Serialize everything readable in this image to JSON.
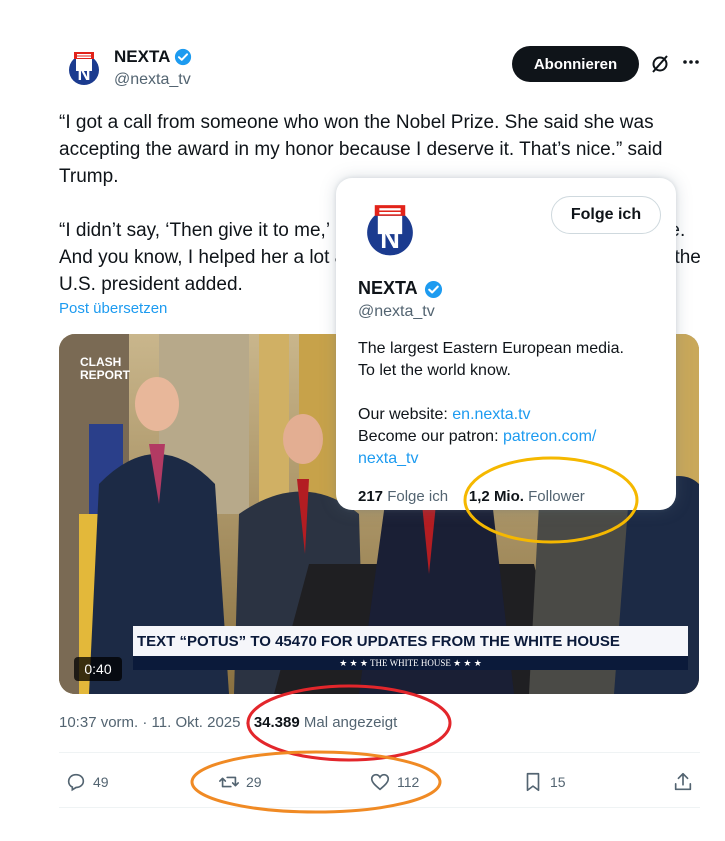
{
  "header": {
    "name": "NEXTA",
    "handle": "@nexta_tv",
    "subscribe_label": "Abonnieren"
  },
  "tweet": {
    "text": "“I got a call from someone who won the Nobel Prize. She said she was accepting the award in my honor because I deserve it. That’s nice.” said Trump.\n\n“I didn’t say, ‘Then give it to me,’ I didn’t say that. I think she was very nice. And you know, I helped her a lot along the way. A disaster in Venezuela,” the U.S. president added.",
    "translate_label": "Post übersetzen"
  },
  "media": {
    "brand_top": "CLASH",
    "brand_bottom": "REPORT",
    "banner_text": "TEXT “POTUS” TO 45470 FOR UPDATES FROM THE WHITE HOUSE",
    "banner_sub": "★ ★ ★   THE WHITE HOUSE   ★ ★ ★",
    "duration": "0:40"
  },
  "meta": {
    "time": "10:37 vorm. · 11. Okt. 2025 · ",
    "views": "34.389",
    "views_label": " Mal angezeigt"
  },
  "actions": {
    "replies": "49",
    "reposts": "29",
    "likes": "112",
    "bookmarks": "15"
  },
  "hover_card": {
    "follow_label": "Folge ich",
    "name": "NEXTA",
    "handle": "@nexta_tv",
    "bio_line1": "The largest Eastern European media.",
    "bio_line2": "To let the world know.",
    "website_prefix": "Our website: ",
    "website_link": "en.nexta.tv",
    "patron_prefix": "Become our patron: ",
    "patron_link_1": "patreon.com/",
    "patron_link_2": "nexta_tv",
    "following_count": "217",
    "following_label": " Folge ich",
    "followers_count": "1,2 Mio.",
    "followers_label": " Follower"
  },
  "colors": {
    "accent": "#1d9bf0",
    "annotation_yellow": "#f5b800",
    "annotation_red": "#e3262b",
    "annotation_orange": "#f08a24"
  },
  "icons": [
    "verified-badge-icon",
    "grok-icon",
    "more-icon",
    "reply-icon",
    "repost-icon",
    "like-icon",
    "bookmark-icon",
    "share-icon"
  ]
}
